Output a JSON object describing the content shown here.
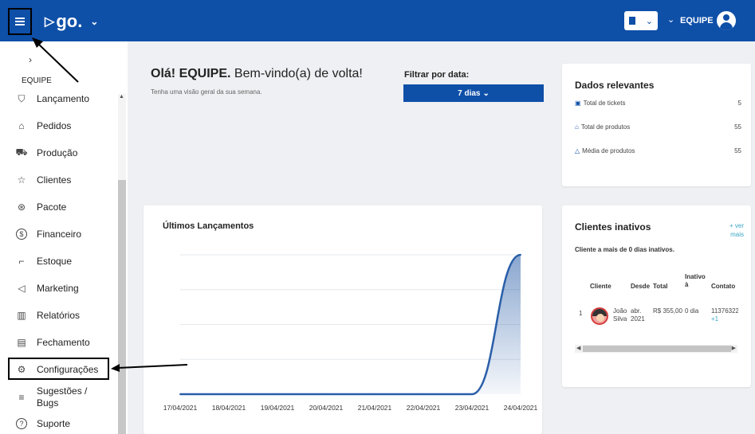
{
  "header": {
    "logo_text": "go.",
    "user_name": "EQUIPE",
    "brand_color": "#0e4fa8"
  },
  "sidebar": {
    "group_label": "EQUIPE",
    "items": [
      {
        "label": "Lançamento",
        "icon": "cart-icon"
      },
      {
        "label": "Pedidos",
        "icon": "shirt-icon"
      },
      {
        "label": "Produção",
        "icon": "truck-icon"
      },
      {
        "label": "Clientes",
        "icon": "star-icon"
      },
      {
        "label": "Pacote",
        "icon": "package-icon"
      },
      {
        "label": "Financeiro",
        "icon": "dollar-icon"
      },
      {
        "label": "Estoque",
        "icon": "dolly-icon"
      },
      {
        "label": "Marketing",
        "icon": "megaphone-icon"
      },
      {
        "label": "Relatórios",
        "icon": "bar-chart-icon"
      },
      {
        "label": "Fechamento",
        "icon": "register-icon"
      },
      {
        "label": "Configurações",
        "icon": "gear-icon"
      },
      {
        "label": "Sugestões / Bugs",
        "icon": "list-icon"
      },
      {
        "label": "Suporte",
        "icon": "help-icon"
      }
    ]
  },
  "welcome": {
    "greeting_bold": "Olá! EQUIPE.",
    "greeting_rest": " Bem-vindo(a) de volta!",
    "subtitle": "Tenha uma visão geral da sua semana."
  },
  "filter": {
    "label": "Filtrar por data:",
    "value": "7 dias"
  },
  "dados": {
    "title": "Dados relevantes",
    "rows": [
      {
        "label": "Total de tickets",
        "value": "5",
        "icon": "ticket-icon"
      },
      {
        "label": "Total de produtos",
        "value": "55",
        "icon": "shirt-icon"
      },
      {
        "label": "Média de produtos",
        "value": "55",
        "icon": "hanger-icon"
      }
    ]
  },
  "lancamentos": {
    "title": "Últimos Lançamentos"
  },
  "inativos": {
    "title": "Clientes inativos",
    "ver_mais": "+ ver mais",
    "desc": "Cliente a mais de 0 dias inativos.",
    "headers": {
      "cliente": "Cliente",
      "desde": "Desde",
      "total": "Total",
      "inativo": "Inativo à",
      "contato": "Contato"
    },
    "rows": [
      {
        "index": "1",
        "name_line1": "João",
        "name_line2": "Silva",
        "desde_line1": "abr.",
        "desde_line2": "2021",
        "total": "R$ 355,00",
        "inativo": "0 dia",
        "contato_line1": "11376322",
        "contato_line2": "+1"
      }
    ]
  },
  "chart_data": {
    "type": "area",
    "title": "Últimos Lançamentos",
    "categories": [
      "17/04/2021",
      "18/04/2021",
      "19/04/2021",
      "20/04/2021",
      "21/04/2021",
      "22/04/2021",
      "23/04/2021",
      "24/04/2021"
    ],
    "series": [
      {
        "values": [
          0,
          0,
          0,
          0,
          0,
          0,
          0,
          1
        ]
      }
    ],
    "ylim": [
      0,
      1
    ],
    "grid": true,
    "color": "#2a5ea8"
  }
}
